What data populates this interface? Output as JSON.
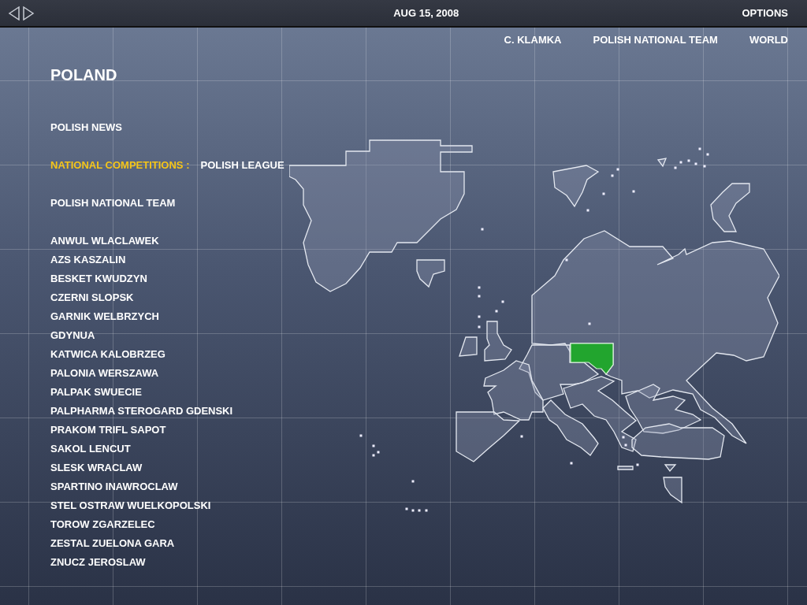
{
  "header": {
    "date": "AUG 15, 2008",
    "options": "OPTIONS"
  },
  "nav": [
    "C. KLAMKA",
    "POLISH NATIONAL TEAM",
    "WORLD"
  ],
  "country": {
    "title": "POLAND",
    "news": "POLISH NEWS",
    "competitions_label": "NATIONAL COMPETITIONS :",
    "competition": "POLISH LEAGUE",
    "national_team": "POLISH NATIONAL TEAM",
    "clubs": [
      "ANWUL WLACLAWEK",
      "AZS KASZALIN",
      "BESKET KWUDZYN",
      "CZERNI SLOPSK",
      "GARNIK WELBRZYCH",
      "GDYNUA",
      "KATWICA KALOBRZEG",
      "PALONIA WERSZAWA",
      "PALPAK SWUECIE",
      "PALPHARMA STEROGARD GDENSKI",
      "PRAKOM TRIFL SAPOT",
      "SAKOL LENCUT",
      "SLESK WRACLAW",
      "SPARTINO INAWROCLAW",
      "STEL OSTRAW WUELKOPOLSKI",
      "TOROW ZGARZELEC",
      "ZESTAL ZUELONA GARA",
      "ZNUCZ JEROSLAW"
    ]
  }
}
